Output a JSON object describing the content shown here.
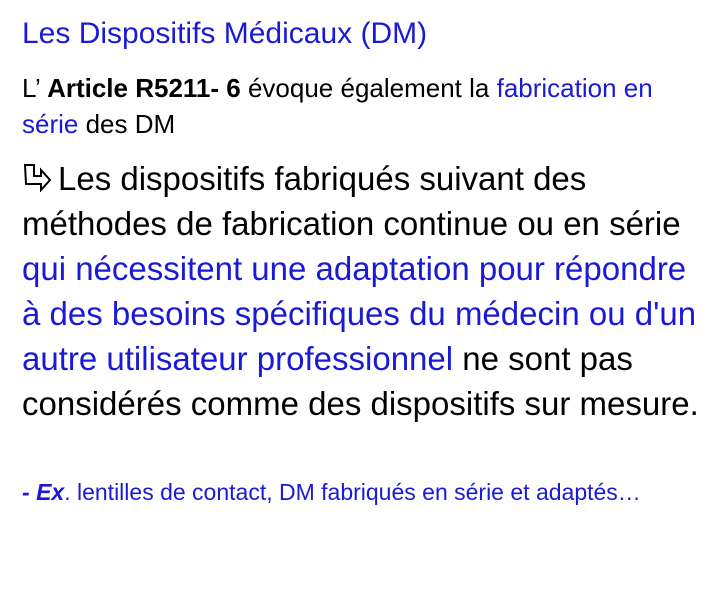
{
  "title": "Les Dispositifs Médicaux (DM)",
  "intro": {
    "prefix": "L’ ",
    "article": "Article R5211- 6",
    "mid": " évoque également la ",
    "highlight": "fabrication en série",
    "suffix": " des DM"
  },
  "main": {
    "bullet_icon": "hollow-right-down-arrow-icon",
    "part1": "Les dispositifs fabriqués suivant des méthodes de fabrication continue ou en série ",
    "highlight": "qui nécessitent une adaptation pour répondre à des besoins spécifiques du médecin ou d'un autre utilisateur professionnel",
    "part2": " ne sont pas considérés comme des dispositifs sur mesure."
  },
  "example": {
    "prefix": "- ",
    "label": "Ex",
    "text": ". lentilles de contact, DM fabriqués en série et adaptés…"
  },
  "colors": {
    "accent_blue": "#1a1ad6",
    "text": "#000000",
    "background": "#ffffff"
  }
}
